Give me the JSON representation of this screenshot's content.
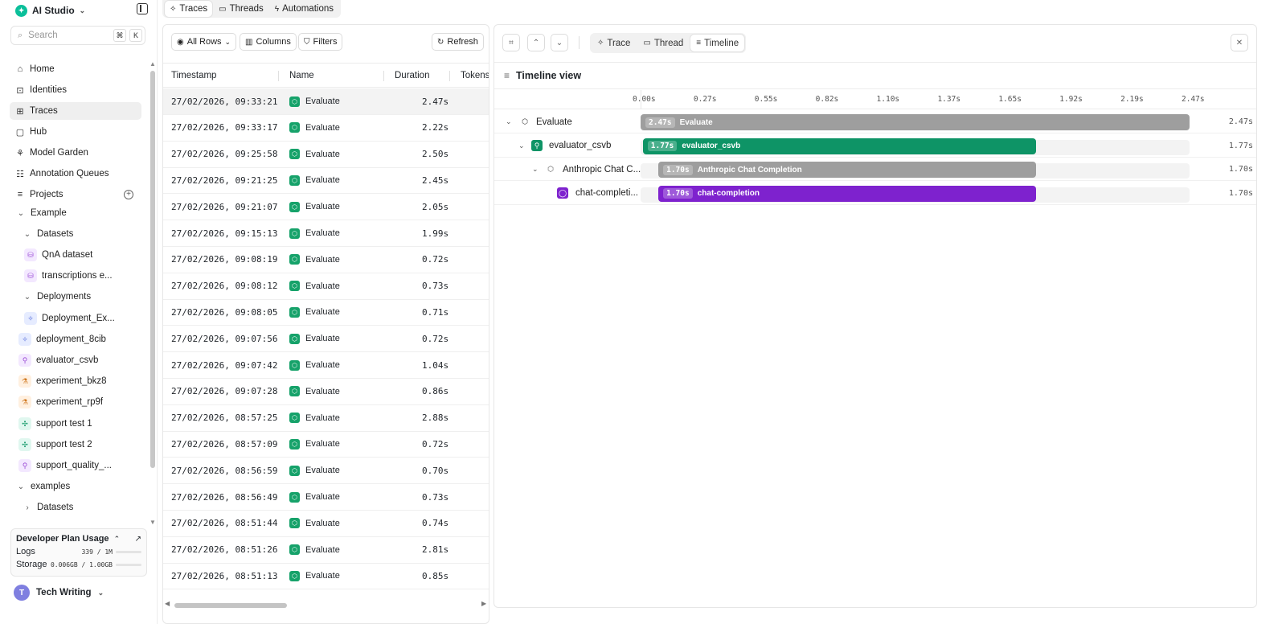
{
  "app": {
    "name": "AI Studio"
  },
  "sidebar": {
    "search_placeholder": "Search",
    "kbd_cmd": "⌘",
    "kbd_k": "K",
    "nav": [
      {
        "label": "Home",
        "icon": "home-icon"
      },
      {
        "label": "Identities",
        "icon": "identities-icon"
      },
      {
        "label": "Traces",
        "icon": "traces-icon"
      },
      {
        "label": "Hub",
        "icon": "hub-icon"
      },
      {
        "label": "Model Garden",
        "icon": "model-garden-icon"
      },
      {
        "label": "Annotation Queues",
        "icon": "annotation-icon"
      },
      {
        "label": "Projects",
        "icon": "projects-icon"
      }
    ],
    "tree": [
      {
        "label": "Example"
      },
      {
        "label": "Datasets"
      },
      {
        "label": "QnA dataset"
      },
      {
        "label": "transcriptions e..."
      },
      {
        "label": "Deployments"
      },
      {
        "label": "Deployment_Ex..."
      },
      {
        "label": "deployment_8cib"
      },
      {
        "label": "evaluator_csvb"
      },
      {
        "label": "experiment_bkz8"
      },
      {
        "label": "experiment_rp9f"
      },
      {
        "label": "support test 1"
      },
      {
        "label": "support test 2"
      },
      {
        "label": "support_quality_..."
      },
      {
        "label": "examples"
      },
      {
        "label": "Datasets"
      }
    ],
    "usage": {
      "title": "Developer Plan Usage",
      "logs_label": "Logs",
      "logs_value": "339 / 1M",
      "logs_fraction": 0.0003,
      "storage_label": "Storage",
      "storage_value": "0.006GB / 1.00GB",
      "storage_fraction": 0.006
    },
    "user": {
      "initial": "T",
      "name": "Tech Writing"
    }
  },
  "top_tabs": [
    {
      "label": "Traces",
      "active": true
    },
    {
      "label": "Threads",
      "active": false
    },
    {
      "label": "Automations",
      "active": false
    }
  ],
  "table": {
    "toolbar": {
      "all_rows": "All Rows",
      "columns": "Columns",
      "filters": "Filters",
      "refresh": "Refresh"
    },
    "columns": [
      "Timestamp",
      "Name",
      "Duration",
      "Tokens"
    ],
    "rows": [
      {
        "timestamp": "27/02/2026, 09:33:21",
        "name": "Evaluate",
        "duration": "2.47s"
      },
      {
        "timestamp": "27/02/2026, 09:33:17",
        "name": "Evaluate",
        "duration": "2.22s"
      },
      {
        "timestamp": "27/02/2026, 09:25:58",
        "name": "Evaluate",
        "duration": "2.50s"
      },
      {
        "timestamp": "27/02/2026, 09:21:25",
        "name": "Evaluate",
        "duration": "2.45s"
      },
      {
        "timestamp": "27/02/2026, 09:21:07",
        "name": "Evaluate",
        "duration": "2.05s"
      },
      {
        "timestamp": "27/02/2026, 09:15:13",
        "name": "Evaluate",
        "duration": "1.99s"
      },
      {
        "timestamp": "27/02/2026, 09:08:19",
        "name": "Evaluate",
        "duration": "0.72s"
      },
      {
        "timestamp": "27/02/2026, 09:08:12",
        "name": "Evaluate",
        "duration": "0.73s"
      },
      {
        "timestamp": "27/02/2026, 09:08:05",
        "name": "Evaluate",
        "duration": "0.71s"
      },
      {
        "timestamp": "27/02/2026, 09:07:56",
        "name": "Evaluate",
        "duration": "0.72s"
      },
      {
        "timestamp": "27/02/2026, 09:07:42",
        "name": "Evaluate",
        "duration": "1.04s"
      },
      {
        "timestamp": "27/02/2026, 09:07:28",
        "name": "Evaluate",
        "duration": "0.86s"
      },
      {
        "timestamp": "27/02/2026, 08:57:25",
        "name": "Evaluate",
        "duration": "2.88s"
      },
      {
        "timestamp": "27/02/2026, 08:57:09",
        "name": "Evaluate",
        "duration": "0.72s"
      },
      {
        "timestamp": "27/02/2026, 08:56:59",
        "name": "Evaluate",
        "duration": "0.70s"
      },
      {
        "timestamp": "27/02/2026, 08:56:49",
        "name": "Evaluate",
        "duration": "0.73s"
      },
      {
        "timestamp": "27/02/2026, 08:51:44",
        "name": "Evaluate",
        "duration": "0.74s"
      },
      {
        "timestamp": "27/02/2026, 08:51:26",
        "name": "Evaluate",
        "duration": "2.81s"
      },
      {
        "timestamp": "27/02/2026, 08:51:13",
        "name": "Evaluate",
        "duration": "0.85s"
      }
    ]
  },
  "detail": {
    "view_tabs": [
      {
        "label": "Trace",
        "active": false
      },
      {
        "label": "Thread",
        "active": false
      },
      {
        "label": "Timeline",
        "active": true
      }
    ],
    "timeline_title": "Timeline view",
    "ticks": [
      "0.00s",
      "0.27s",
      "0.55s",
      "0.82s",
      "1.10s",
      "1.37s",
      "1.65s",
      "1.92s",
      "2.19s",
      "2.47s"
    ],
    "scale_max": 2.47,
    "spans": [
      {
        "name": "Evaluate",
        "start": 0.0,
        "duration": 2.47,
        "duration_label": "2.47s",
        "bar_label": "Evaluate",
        "color": "#9e9e9e"
      },
      {
        "name": "evaluator_csvb",
        "start": 0.01,
        "duration": 1.77,
        "duration_label": "1.77s",
        "bar_label": "evaluator_csvb",
        "color": "#0e9466"
      },
      {
        "name": "Anthropic Chat C...",
        "start": 0.08,
        "duration": 1.7,
        "duration_label": "1.70s",
        "bar_label": "Anthropic Chat Completion",
        "color": "#9e9e9e"
      },
      {
        "name": "chat-completi...",
        "start": 0.08,
        "duration": 1.7,
        "duration_label": "1.70s",
        "bar_label": "chat-completion",
        "color": "#7e22ce"
      }
    ]
  }
}
